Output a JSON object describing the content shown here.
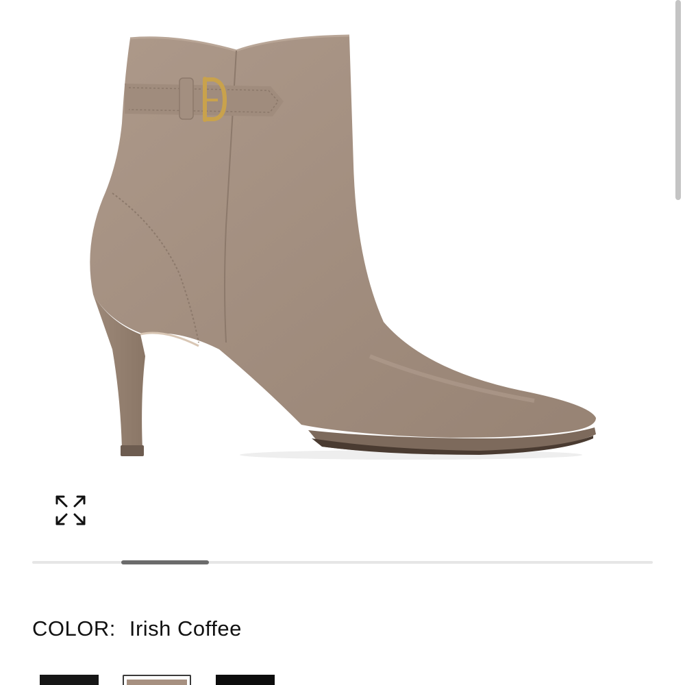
{
  "product": {
    "image_alt": "Taupe suede stiletto ankle boot with buckle strap",
    "color_label": "COLOR:",
    "color_value": "Irish Coffee"
  },
  "icons": {
    "expand": "expand-arrows-icon"
  },
  "carousel": {
    "slide_count": 7,
    "active_slide": 2
  },
  "swatches": [
    {
      "name": "black",
      "color": "#161616",
      "selected": false
    },
    {
      "name": "irish-coffee",
      "color": "#a69080",
      "selected": true
    },
    {
      "name": "black-2",
      "color": "#0d0d0d",
      "selected": false
    }
  ],
  "colors": {
    "suede": "#a69283",
    "buckle": "#c9a24c",
    "scroll_thumb": "#6b6b6b"
  }
}
